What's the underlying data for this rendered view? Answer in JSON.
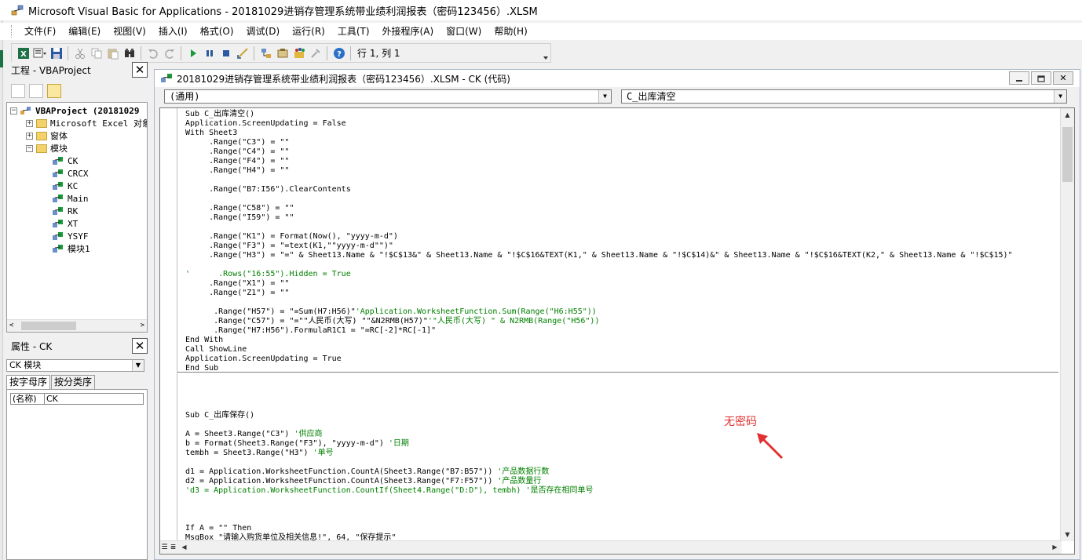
{
  "window": {
    "title": "Microsoft Visual Basic for Applications - 20181029进销存管理系统带业绩利润报表（密码123456）.XLSM"
  },
  "menu": [
    "文件(F)",
    "编辑(E)",
    "视图(V)",
    "插入(I)",
    "格式(O)",
    "调试(D)",
    "运行(R)",
    "工具(T)",
    "外接程序(A)",
    "窗口(W)",
    "帮助(H)"
  ],
  "toolbar": {
    "icons": [
      "excel-view-icon",
      "insert-module-icon",
      "save-icon",
      "cut-icon",
      "copy-icon",
      "paste-icon",
      "find-icon",
      "undo-icon",
      "redo-icon",
      "run-icon",
      "break-icon",
      "reset-icon",
      "design-mode-icon",
      "project-explorer-icon",
      "properties-icon",
      "object-browser-icon",
      "toolbox-icon",
      "help-icon"
    ],
    "position": "行 1, 列 1"
  },
  "project": {
    "title": "工程 - VBAProject",
    "root": "VBAProject (20181029",
    "folders": [
      "Microsoft Excel 对象",
      "窗体",
      "模块"
    ],
    "modules": [
      "CK",
      "CRCX",
      "KC",
      "Main",
      "RK",
      "XT",
      "YSYF",
      "模块1"
    ]
  },
  "properties": {
    "title": "属性 - CK",
    "object": "CK 模块",
    "tabs": [
      "按字母序",
      "按分类序"
    ],
    "rows": [
      {
        "key": "(名称)",
        "value": "CK"
      }
    ]
  },
  "code_window": {
    "title": "20181029进销存管理系统带业绩利润报表（密码123456）.XLSM - CK (代码)",
    "object_combo": "(通用)",
    "proc_combo": "C_出库清空"
  },
  "code_lines": [
    {
      "t": "Sub C_出库清空()"
    },
    {
      "t": "Application.ScreenUpdating = False"
    },
    {
      "t": "With Sheet3"
    },
    {
      "t": "     .Range(\"C3\") = \"\""
    },
    {
      "t": "     .Range(\"C4\") = \"\""
    },
    {
      "t": "     .Range(\"F4\") = \"\""
    },
    {
      "t": "     .Range(\"H4\") = \"\""
    },
    {
      "t": ""
    },
    {
      "t": "     .Range(\"B7:I56\").ClearContents"
    },
    {
      "t": ""
    },
    {
      "t": "     .Range(\"C58\") = \"\""
    },
    {
      "t": "     .Range(\"I59\") = \"\""
    },
    {
      "t": ""
    },
    {
      "t": "     .Range(\"K1\") = Format(Now(), \"yyyy-m-d\")"
    },
    {
      "t": "     .Range(\"F3\") = \"=text(K1,\"\"yyyy-m-d\"\")\""
    },
    {
      "t": "     .Range(\"H3\") = \"=\" & Sheet13.Name & \"!$C$13&\" & Sheet13.Name & \"!$C$16&TEXT(K1,\" & Sheet13.Name & \"!$C$14)&\" & Sheet13.Name & \"!$C$16&TEXT(K2,\" & Sheet13.Name & \"!$C$15)\""
    },
    {
      "t": ""
    },
    {
      "t": "'      .Rows(\"16:55\").Hidden = True",
      "c": 1
    },
    {
      "t": "     .Range(\"X1\") = \"\""
    },
    {
      "t": "     .Range(\"Z1\") = \"\""
    },
    {
      "t": ""
    },
    {
      "t": "      .Range(\"H57\") = \"=Sum(H7:H56)\"",
      "cm": "'Application.WorksheetFunction.Sum(Range(\"H6:H55\"))"
    },
    {
      "t": "      .Range(\"C57\") = \"=\"\"人民币(大写) \"\"&N2RMB(H57)\"",
      "cm": "'\"人民币(大写) \" & N2RMB(Range(\"H56\"))"
    },
    {
      "t": "      .Range(\"H7:H56\").FormulaR1C1 = \"=RC[-2]*RC[-1]\""
    },
    {
      "t": "End With"
    },
    {
      "t": "Call ShowLine"
    },
    {
      "t": "Application.ScreenUpdating = True"
    },
    {
      "t": "End Sub"
    },
    {
      "t": ""
    },
    {
      "t": ""
    },
    {
      "t": ""
    },
    {
      "t": ""
    },
    {
      "t": "Sub C_出库保存()"
    },
    {
      "t": ""
    },
    {
      "t": "A = Sheet3.Range(\"C3\") ",
      "cm": "'供应商"
    },
    {
      "t": "b = Format(Sheet3.Range(\"F3\"), \"yyyy-m-d\") ",
      "cm": "'日期"
    },
    {
      "t": "tembh = Sheet3.Range(\"H3\") ",
      "cm": "'单号"
    },
    {
      "t": ""
    },
    {
      "t": "d1 = Application.WorksheetFunction.CountA(Sheet3.Range(\"B7:B57\")) ",
      "cm": "'产品数据行数"
    },
    {
      "t": "d2 = Application.WorksheetFunction.CountA(Sheet3.Range(\"F7:F57\")) ",
      "cm": "'产品数量行"
    },
    {
      "t": "'d3 = Application.WorksheetFunction.CountIf(Sheet4.Range(\"D:D\"), tembh) '是否存在相同单号",
      "c": 1
    },
    {
      "t": ""
    },
    {
      "t": ""
    },
    {
      "t": ""
    },
    {
      "t": "If A = \"\" Then"
    },
    {
      "t": "MsgBox \"请输入购货单位及相关信息!\", 64, \"保存提示\""
    }
  ],
  "annotation": {
    "text": "无密码",
    "color": "#e03030"
  },
  "colors": {
    "comment": "#008000",
    "keyword": "#00007f",
    "folder": "#f3d26b",
    "excel_green": "#1e7145"
  }
}
